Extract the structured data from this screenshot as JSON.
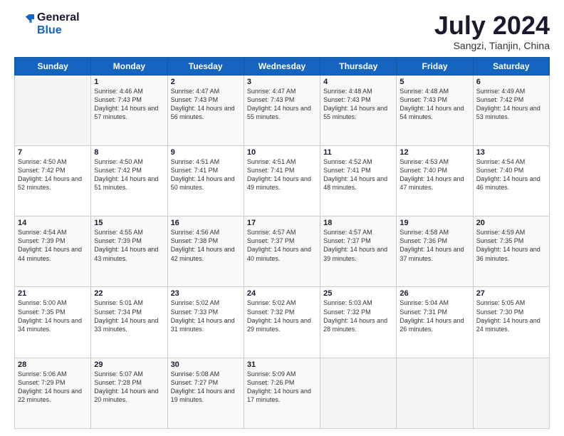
{
  "logo": {
    "line1": "General",
    "line2": "Blue"
  },
  "title": "July 2024",
  "subtitle": "Sangzi, Tianjin, China",
  "weekdays": [
    "Sunday",
    "Monday",
    "Tuesday",
    "Wednesday",
    "Thursday",
    "Friday",
    "Saturday"
  ],
  "weeks": [
    [
      null,
      {
        "day": "1",
        "sunrise": "4:46 AM",
        "sunset": "7:43 PM",
        "daylight": "14 hours and 57 minutes."
      },
      {
        "day": "2",
        "sunrise": "4:47 AM",
        "sunset": "7:43 PM",
        "daylight": "14 hours and 56 minutes."
      },
      {
        "day": "3",
        "sunrise": "4:47 AM",
        "sunset": "7:43 PM",
        "daylight": "14 hours and 55 minutes."
      },
      {
        "day": "4",
        "sunrise": "4:48 AM",
        "sunset": "7:43 PM",
        "daylight": "14 hours and 55 minutes."
      },
      {
        "day": "5",
        "sunrise": "4:48 AM",
        "sunset": "7:43 PM",
        "daylight": "14 hours and 54 minutes."
      },
      {
        "day": "6",
        "sunrise": "4:49 AM",
        "sunset": "7:42 PM",
        "daylight": "14 hours and 53 minutes."
      }
    ],
    [
      {
        "day": "7",
        "sunrise": "4:50 AM",
        "sunset": "7:42 PM",
        "daylight": "14 hours and 52 minutes."
      },
      {
        "day": "8",
        "sunrise": "4:50 AM",
        "sunset": "7:42 PM",
        "daylight": "14 hours and 51 minutes."
      },
      {
        "day": "9",
        "sunrise": "4:51 AM",
        "sunset": "7:41 PM",
        "daylight": "14 hours and 50 minutes."
      },
      {
        "day": "10",
        "sunrise": "4:51 AM",
        "sunset": "7:41 PM",
        "daylight": "14 hours and 49 minutes."
      },
      {
        "day": "11",
        "sunrise": "4:52 AM",
        "sunset": "7:41 PM",
        "daylight": "14 hours and 48 minutes."
      },
      {
        "day": "12",
        "sunrise": "4:53 AM",
        "sunset": "7:40 PM",
        "daylight": "14 hours and 47 minutes."
      },
      {
        "day": "13",
        "sunrise": "4:54 AM",
        "sunset": "7:40 PM",
        "daylight": "14 hours and 46 minutes."
      }
    ],
    [
      {
        "day": "14",
        "sunrise": "4:54 AM",
        "sunset": "7:39 PM",
        "daylight": "14 hours and 44 minutes."
      },
      {
        "day": "15",
        "sunrise": "4:55 AM",
        "sunset": "7:39 PM",
        "daylight": "14 hours and 43 minutes."
      },
      {
        "day": "16",
        "sunrise": "4:56 AM",
        "sunset": "7:38 PM",
        "daylight": "14 hours and 42 minutes."
      },
      {
        "day": "17",
        "sunrise": "4:57 AM",
        "sunset": "7:37 PM",
        "daylight": "14 hours and 40 minutes."
      },
      {
        "day": "18",
        "sunrise": "4:57 AM",
        "sunset": "7:37 PM",
        "daylight": "14 hours and 39 minutes."
      },
      {
        "day": "19",
        "sunrise": "4:58 AM",
        "sunset": "7:36 PM",
        "daylight": "14 hours and 37 minutes."
      },
      {
        "day": "20",
        "sunrise": "4:59 AM",
        "sunset": "7:35 PM",
        "daylight": "14 hours and 36 minutes."
      }
    ],
    [
      {
        "day": "21",
        "sunrise": "5:00 AM",
        "sunset": "7:35 PM",
        "daylight": "14 hours and 34 minutes."
      },
      {
        "day": "22",
        "sunrise": "5:01 AM",
        "sunset": "7:34 PM",
        "daylight": "14 hours and 33 minutes."
      },
      {
        "day": "23",
        "sunrise": "5:02 AM",
        "sunset": "7:33 PM",
        "daylight": "14 hours and 31 minutes."
      },
      {
        "day": "24",
        "sunrise": "5:02 AM",
        "sunset": "7:32 PM",
        "daylight": "14 hours and 29 minutes."
      },
      {
        "day": "25",
        "sunrise": "5:03 AM",
        "sunset": "7:32 PM",
        "daylight": "14 hours and 28 minutes."
      },
      {
        "day": "26",
        "sunrise": "5:04 AM",
        "sunset": "7:31 PM",
        "daylight": "14 hours and 26 minutes."
      },
      {
        "day": "27",
        "sunrise": "5:05 AM",
        "sunset": "7:30 PM",
        "daylight": "14 hours and 24 minutes."
      }
    ],
    [
      {
        "day": "28",
        "sunrise": "5:06 AM",
        "sunset": "7:29 PM",
        "daylight": "14 hours and 22 minutes."
      },
      {
        "day": "29",
        "sunrise": "5:07 AM",
        "sunset": "7:28 PM",
        "daylight": "14 hours and 20 minutes."
      },
      {
        "day": "30",
        "sunrise": "5:08 AM",
        "sunset": "7:27 PM",
        "daylight": "14 hours and 19 minutes."
      },
      {
        "day": "31",
        "sunrise": "5:09 AM",
        "sunset": "7:26 PM",
        "daylight": "14 hours and 17 minutes."
      },
      null,
      null,
      null
    ]
  ]
}
